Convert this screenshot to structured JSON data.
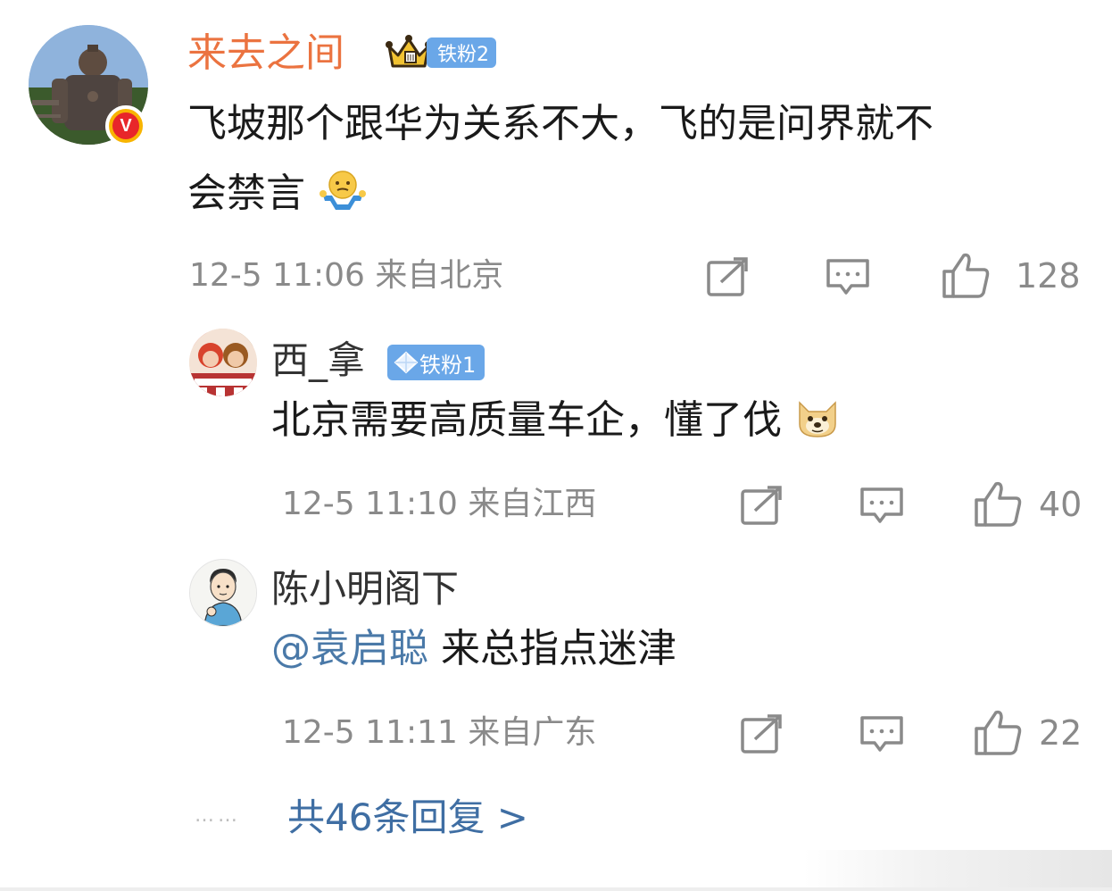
{
  "main_comment": {
    "username": "来去之间",
    "fan_badge": "铁粉2",
    "verified_mark": "V",
    "text_line1": "飞坡那个跟华为关系不大，飞的是问界就不",
    "text_line2": "会禁言",
    "emoji": "shrug-emoji",
    "timestamp": "12-5 11:06 来自北京",
    "like_count": "128"
  },
  "replies": [
    {
      "username": "西_拿",
      "fan_badge": "铁粉1",
      "text": "北京需要高质量车企，懂了伐",
      "emoji": "doge-emoji",
      "timestamp": "12-5 11:10 来自江西",
      "like_count": "40"
    },
    {
      "username": "陈小明阁下",
      "mention": "@袁启聪",
      "text": " 来总指点迷津",
      "timestamp": "12-5 11:11 来自广东",
      "like_count": "22"
    }
  ],
  "more_replies": "共46条回复 >",
  "dots": "……",
  "colors": {
    "username_orange": "#eb7340",
    "link_blue": "#3f6ea3",
    "badge_blue": "#6aa7e8",
    "meta_gray": "#8a8a8a"
  }
}
